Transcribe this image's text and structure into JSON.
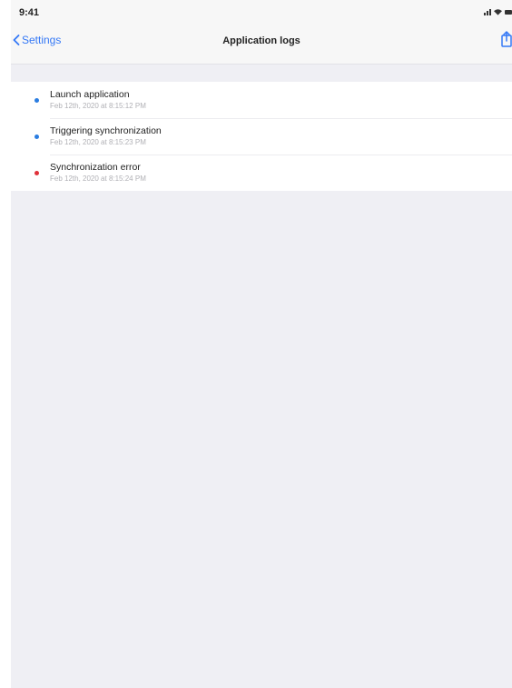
{
  "status_bar": {
    "time": "9:41"
  },
  "nav_bar": {
    "back_label": "Settings",
    "title": "Application logs",
    "share_icon": "share-icon"
  },
  "colors": {
    "accent": "#3478f6",
    "info": "#2a7de1",
    "error": "#e0313a",
    "background": "#efeff4"
  },
  "logs": [
    {
      "title": "Launch application",
      "time": "Feb 12th, 2020 at 8:15:12 PM",
      "level": "info"
    },
    {
      "title": "Triggering synchronization",
      "time": "Feb 12th, 2020 at 8:15:23 PM",
      "level": "info"
    },
    {
      "title": "Synchronization error",
      "time": "Feb 12th, 2020 at 8:15:24 PM",
      "level": "error"
    }
  ]
}
